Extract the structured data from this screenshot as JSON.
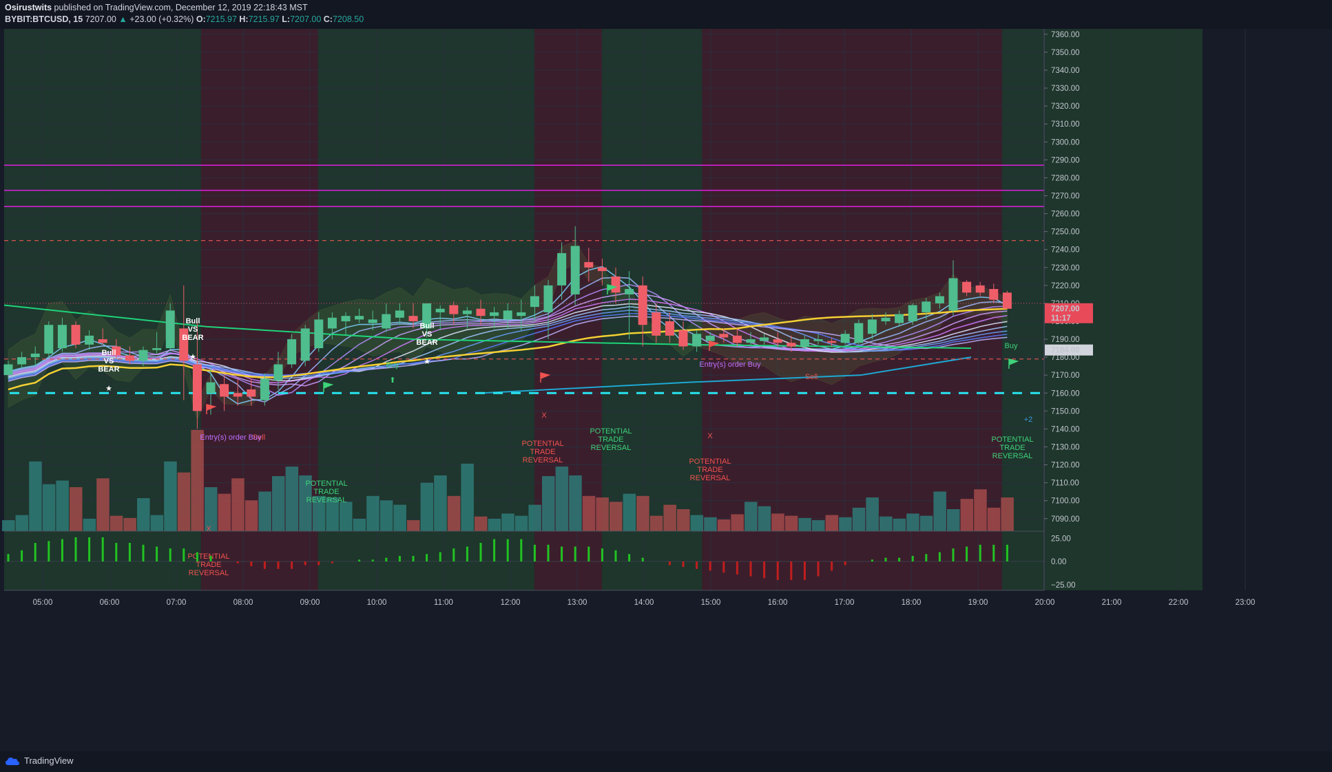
{
  "header": {
    "author": "Osirustwits",
    "published_text": " published on TradingView.com, December 12, 2019 22:18:43 MST",
    "symbol": "BYBIT:BTCUSD, 15",
    "last": "7207.00",
    "change": "+23.00 (+0.32%)",
    "o_label": "O:",
    "o": "7215.97",
    "h_label": "H:",
    "h": "7215.97",
    "l_label": "L:",
    "l": "7207.00",
    "c_label": "C:",
    "c": "7208.50"
  },
  "colors": {
    "bull": "#26a69a",
    "bear": "#ef5350",
    "bull_zone": "#1f3a2e",
    "bear_zone": "#3f1f2c",
    "magenta": "#e020e0",
    "cyan": "#28e4f0",
    "yellow": "#f5d033"
  },
  "price_axis": {
    "labels": [
      "7360.00",
      "7350.00",
      "7340.00",
      "7330.00",
      "7320.00",
      "7310.00",
      "7300.00",
      "7290.00",
      "7280.00",
      "7270.00",
      "7260.00",
      "7250.00",
      "7240.00",
      "7230.00",
      "7220.00",
      "7210.00",
      "7200.00",
      "7190.00",
      "7180.00",
      "7170.00",
      "7160.00",
      "7150.00",
      "7140.00",
      "7130.00",
      "7120.00",
      "7110.00",
      "7100.00",
      "7090.00"
    ],
    "current_price_tag": "7207.00",
    "countdown_tag": "11:17",
    "level_tag": "7184.00"
  },
  "oscillator_axis": {
    "labels": [
      "25.00",
      "0.00",
      "−25.00"
    ]
  },
  "time_axis": {
    "labels": [
      "05:00",
      "06:00",
      "07:00",
      "08:00",
      "09:00",
      "10:00",
      "11:00",
      "12:00",
      "13:00",
      "14:00",
      "15:00",
      "16:00",
      "17:00",
      "18:00",
      "19:00",
      "20:00",
      "21:00",
      "22:00",
      "23:00"
    ]
  },
  "horizontal_levels": {
    "magenta": [
      7287,
      7273,
      7264
    ],
    "dashed_red": [
      7245,
      7179
    ],
    "cyan_dashed": 7160,
    "dotted_red": 7210
  },
  "annotations": {
    "bull_vs_bear": [
      "Bull",
      "VS",
      "BEAR"
    ],
    "potential_trade_reversal": [
      "POTENTIAL",
      "TRADE",
      "REVERSAL"
    ],
    "buy": "Buy",
    "sell": "Sell",
    "entry_buy": "Entry(s) order Buy",
    "plus_two": "+2",
    "x_mark": "X"
  },
  "footer": {
    "brand": "TradingView"
  },
  "chart_data": {
    "type": "candlestick",
    "interval": "15",
    "y_range": [
      7083,
      7363
    ],
    "candles_ohlc": [
      [
        7170,
        7178,
        7168,
        7176
      ],
      [
        7176,
        7183,
        7174,
        7180
      ],
      [
        7180,
        7186,
        7175,
        7182
      ],
      [
        7182,
        7200,
        7180,
        7198
      ],
      [
        7185,
        7202,
        7183,
        7198
      ],
      [
        7198,
        7200,
        7185,
        7187
      ],
      [
        7187,
        7195,
        7184,
        7192
      ],
      [
        7190,
        7196,
        7187,
        7188
      ],
      [
        7186,
        7190,
        7179,
        7181
      ],
      [
        7181,
        7186,
        7176,
        7178
      ],
      [
        7178,
        7186,
        7175,
        7184
      ],
      [
        7184,
        7194,
        7182,
        7185
      ],
      [
        7185,
        7210,
        7183,
        7206
      ],
      [
        7196,
        7220,
        7156,
        7178
      ],
      [
        7176,
        7200,
        7140,
        7150
      ],
      [
        7160,
        7175,
        7148,
        7166
      ],
      [
        7165,
        7170,
        7150,
        7158
      ],
      [
        7160,
        7168,
        7153,
        7158
      ],
      [
        7162,
        7168,
        7153,
        7158
      ],
      [
        7156,
        7171,
        7153,
        7168
      ],
      [
        7167,
        7183,
        7162,
        7176
      ],
      [
        7176,
        7193,
        7174,
        7190
      ],
      [
        7178,
        7198,
        7175,
        7196
      ],
      [
        7185,
        7205,
        7183,
        7201
      ],
      [
        7196,
        7205,
        7190,
        7202
      ],
      [
        7200,
        7205,
        7192,
        7203
      ],
      [
        7201,
        7207,
        7199,
        7203
      ],
      [
        7199,
        7206,
        7195,
        7201
      ],
      [
        7196,
        7210,
        7194,
        7204
      ],
      [
        7202,
        7210,
        7198,
        7206
      ],
      [
        7203,
        7210,
        7196,
        7200
      ],
      [
        7196,
        7209,
        7191,
        7210
      ],
      [
        7205,
        7209,
        7195,
        7207
      ],
      [
        7209,
        7211,
        7198,
        7204
      ],
      [
        7204,
        7208,
        7196,
        7206
      ],
      [
        7207,
        7212,
        7198,
        7203
      ],
      [
        7203,
        7208,
        7196,
        7205
      ],
      [
        7201,
        7210,
        7196,
        7206
      ],
      [
        7203,
        7212,
        7195,
        7205
      ],
      [
        7208,
        7220,
        7200,
        7214
      ],
      [
        7205,
        7223,
        7190,
        7220
      ],
      [
        7220,
        7244,
        7212,
        7238
      ],
      [
        7215,
        7253,
        7209,
        7242
      ],
      [
        7233,
        7241,
        7222,
        7230
      ],
      [
        7230,
        7235,
        7220,
        7228
      ],
      [
        7225,
        7230,
        7210,
        7216
      ],
      [
        7215,
        7228,
        7190,
        7218
      ],
      [
        7220,
        7225,
        7186,
        7198
      ],
      [
        7205,
        7210,
        7188,
        7192
      ],
      [
        7200,
        7205,
        7188,
        7192
      ],
      [
        7195,
        7200,
        7184,
        7186
      ],
      [
        7186,
        7195,
        7183,
        7193
      ],
      [
        7189,
        7194,
        7187,
        7192
      ],
      [
        7193,
        7196,
        7188,
        7191
      ],
      [
        7192,
        7196,
        7186,
        7188
      ],
      [
        7188,
        7194,
        7186,
        7190
      ],
      [
        7189,
        7193,
        7187,
        7191
      ],
      [
        7190,
        7194,
        7186,
        7188
      ],
      [
        7188,
        7192,
        7183,
        7186
      ],
      [
        7186,
        7192,
        7184,
        7190
      ],
      [
        7189,
        7193,
        7187,
        7190
      ],
      [
        7189,
        7191,
        7186,
        7188
      ],
      [
        7188,
        7195,
        7187,
        7193
      ],
      [
        7188,
        7201,
        7186,
        7199
      ],
      [
        7193,
        7204,
        7190,
        7201
      ],
      [
        7200,
        7205,
        7198,
        7202
      ],
      [
        7199,
        7206,
        7197,
        7204
      ],
      [
        7200,
        7210,
        7198,
        7209
      ],
      [
        7205,
        7213,
        7201,
        7211
      ],
      [
        7210,
        7216,
        7207,
        7214
      ],
      [
        7206,
        7234,
        7203,
        7224
      ],
      [
        7222,
        7223,
        7214,
        7216
      ],
      [
        7220,
        7222,
        7214,
        7216
      ],
      [
        7218,
        7221,
        7210,
        7212
      ],
      [
        7216,
        7217,
        7207,
        7207
      ]
    ],
    "volume": [
      1,
      1,
      5,
      4,
      3,
      3,
      1,
      3,
      1,
      1,
      3,
      1,
      5,
      5,
      6,
      3,
      3,
      3,
      2,
      3,
      5,
      4,
      4,
      3,
      2,
      2,
      1,
      2,
      2,
      2,
      1,
      3,
      4,
      3,
      4,
      1,
      1,
      1,
      1,
      2,
      5,
      4,
      4,
      3,
      2,
      2,
      3,
      2,
      1,
      2,
      2,
      1,
      1,
      1,
      1,
      2,
      2,
      1,
      1,
      1,
      1,
      1,
      1,
      2,
      2,
      1,
      1,
      1,
      1,
      3,
      2,
      2,
      3,
      2,
      2
    ],
    "oscillator": [
      8,
      12,
      20,
      22,
      24,
      26,
      26,
      26,
      20,
      20,
      18,
      16,
      14,
      14,
      10,
      6,
      0,
      -2,
      -5,
      -8,
      -8,
      -8,
      -4,
      -4,
      -2,
      0,
      2,
      2,
      4,
      6,
      6,
      8,
      10,
      14,
      16,
      20,
      24,
      24,
      24,
      18,
      18,
      16,
      16,
      16,
      14,
      12,
      8,
      4,
      0,
      -4,
      -6,
      -8,
      -10,
      -12,
      -14,
      -16,
      -18,
      -20,
      -20,
      -20,
      -16,
      -10,
      -4,
      0,
      2,
      4,
      4,
      6,
      8,
      10,
      14,
      16,
      18,
      18,
      18
    ],
    "ylabel": "",
    "xlabel": ""
  }
}
